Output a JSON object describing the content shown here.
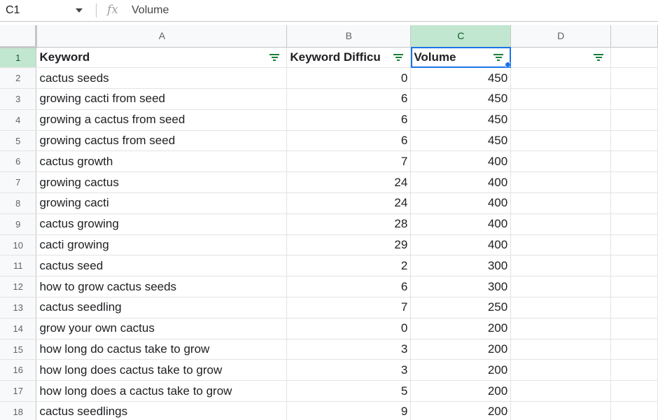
{
  "formula_bar": {
    "name_box": "C1",
    "fx_icon": "fx-icon",
    "value": "Volume"
  },
  "columns": [
    "A",
    "B",
    "C",
    "D"
  ],
  "selected_column": "C",
  "active_cell": "C1",
  "header_row": {
    "row_number": "1",
    "cells": [
      "Keyword",
      "Keyword Difficu",
      "Volume",
      ""
    ]
  },
  "rows": [
    {
      "n": "2",
      "keyword": "cactus seeds",
      "difficulty": "0",
      "volume": "450"
    },
    {
      "n": "3",
      "keyword": "growing cacti from seed",
      "difficulty": "6",
      "volume": "450"
    },
    {
      "n": "4",
      "keyword": "growing a cactus from seed",
      "difficulty": "6",
      "volume": "450"
    },
    {
      "n": "5",
      "keyword": "growing cactus from seed",
      "difficulty": "6",
      "volume": "450"
    },
    {
      "n": "6",
      "keyword": "cactus growth",
      "difficulty": "7",
      "volume": "400"
    },
    {
      "n": "7",
      "keyword": "growing cactus",
      "difficulty": "24",
      "volume": "400"
    },
    {
      "n": "8",
      "keyword": "growing cacti",
      "difficulty": "24",
      "volume": "400"
    },
    {
      "n": "9",
      "keyword": "cactus growing",
      "difficulty": "28",
      "volume": "400"
    },
    {
      "n": "10",
      "keyword": "cacti growing",
      "difficulty": "29",
      "volume": "400"
    },
    {
      "n": "11",
      "keyword": "cactus seed",
      "difficulty": "2",
      "volume": "300"
    },
    {
      "n": "12",
      "keyword": "how to grow cactus seeds",
      "difficulty": "6",
      "volume": "300"
    },
    {
      "n": "13",
      "keyword": "cactus seedling",
      "difficulty": "7",
      "volume": "250"
    },
    {
      "n": "14",
      "keyword": "grow your own cactus",
      "difficulty": "0",
      "volume": "200"
    },
    {
      "n": "15",
      "keyword": "how long do cactus take to grow",
      "difficulty": "3",
      "volume": "200"
    },
    {
      "n": "16",
      "keyword": "how long does cactus take to grow",
      "difficulty": "3",
      "volume": "200"
    },
    {
      "n": "17",
      "keyword": "how long does a cactus take to grow",
      "difficulty": "5",
      "volume": "200"
    },
    {
      "n": "18",
      "keyword": "cactus seedlings",
      "difficulty": "9",
      "volume": "200"
    }
  ],
  "colors": {
    "selection": "#1a73e8",
    "selected_header": "#c2e7d0",
    "filter_icon": "#188038"
  }
}
